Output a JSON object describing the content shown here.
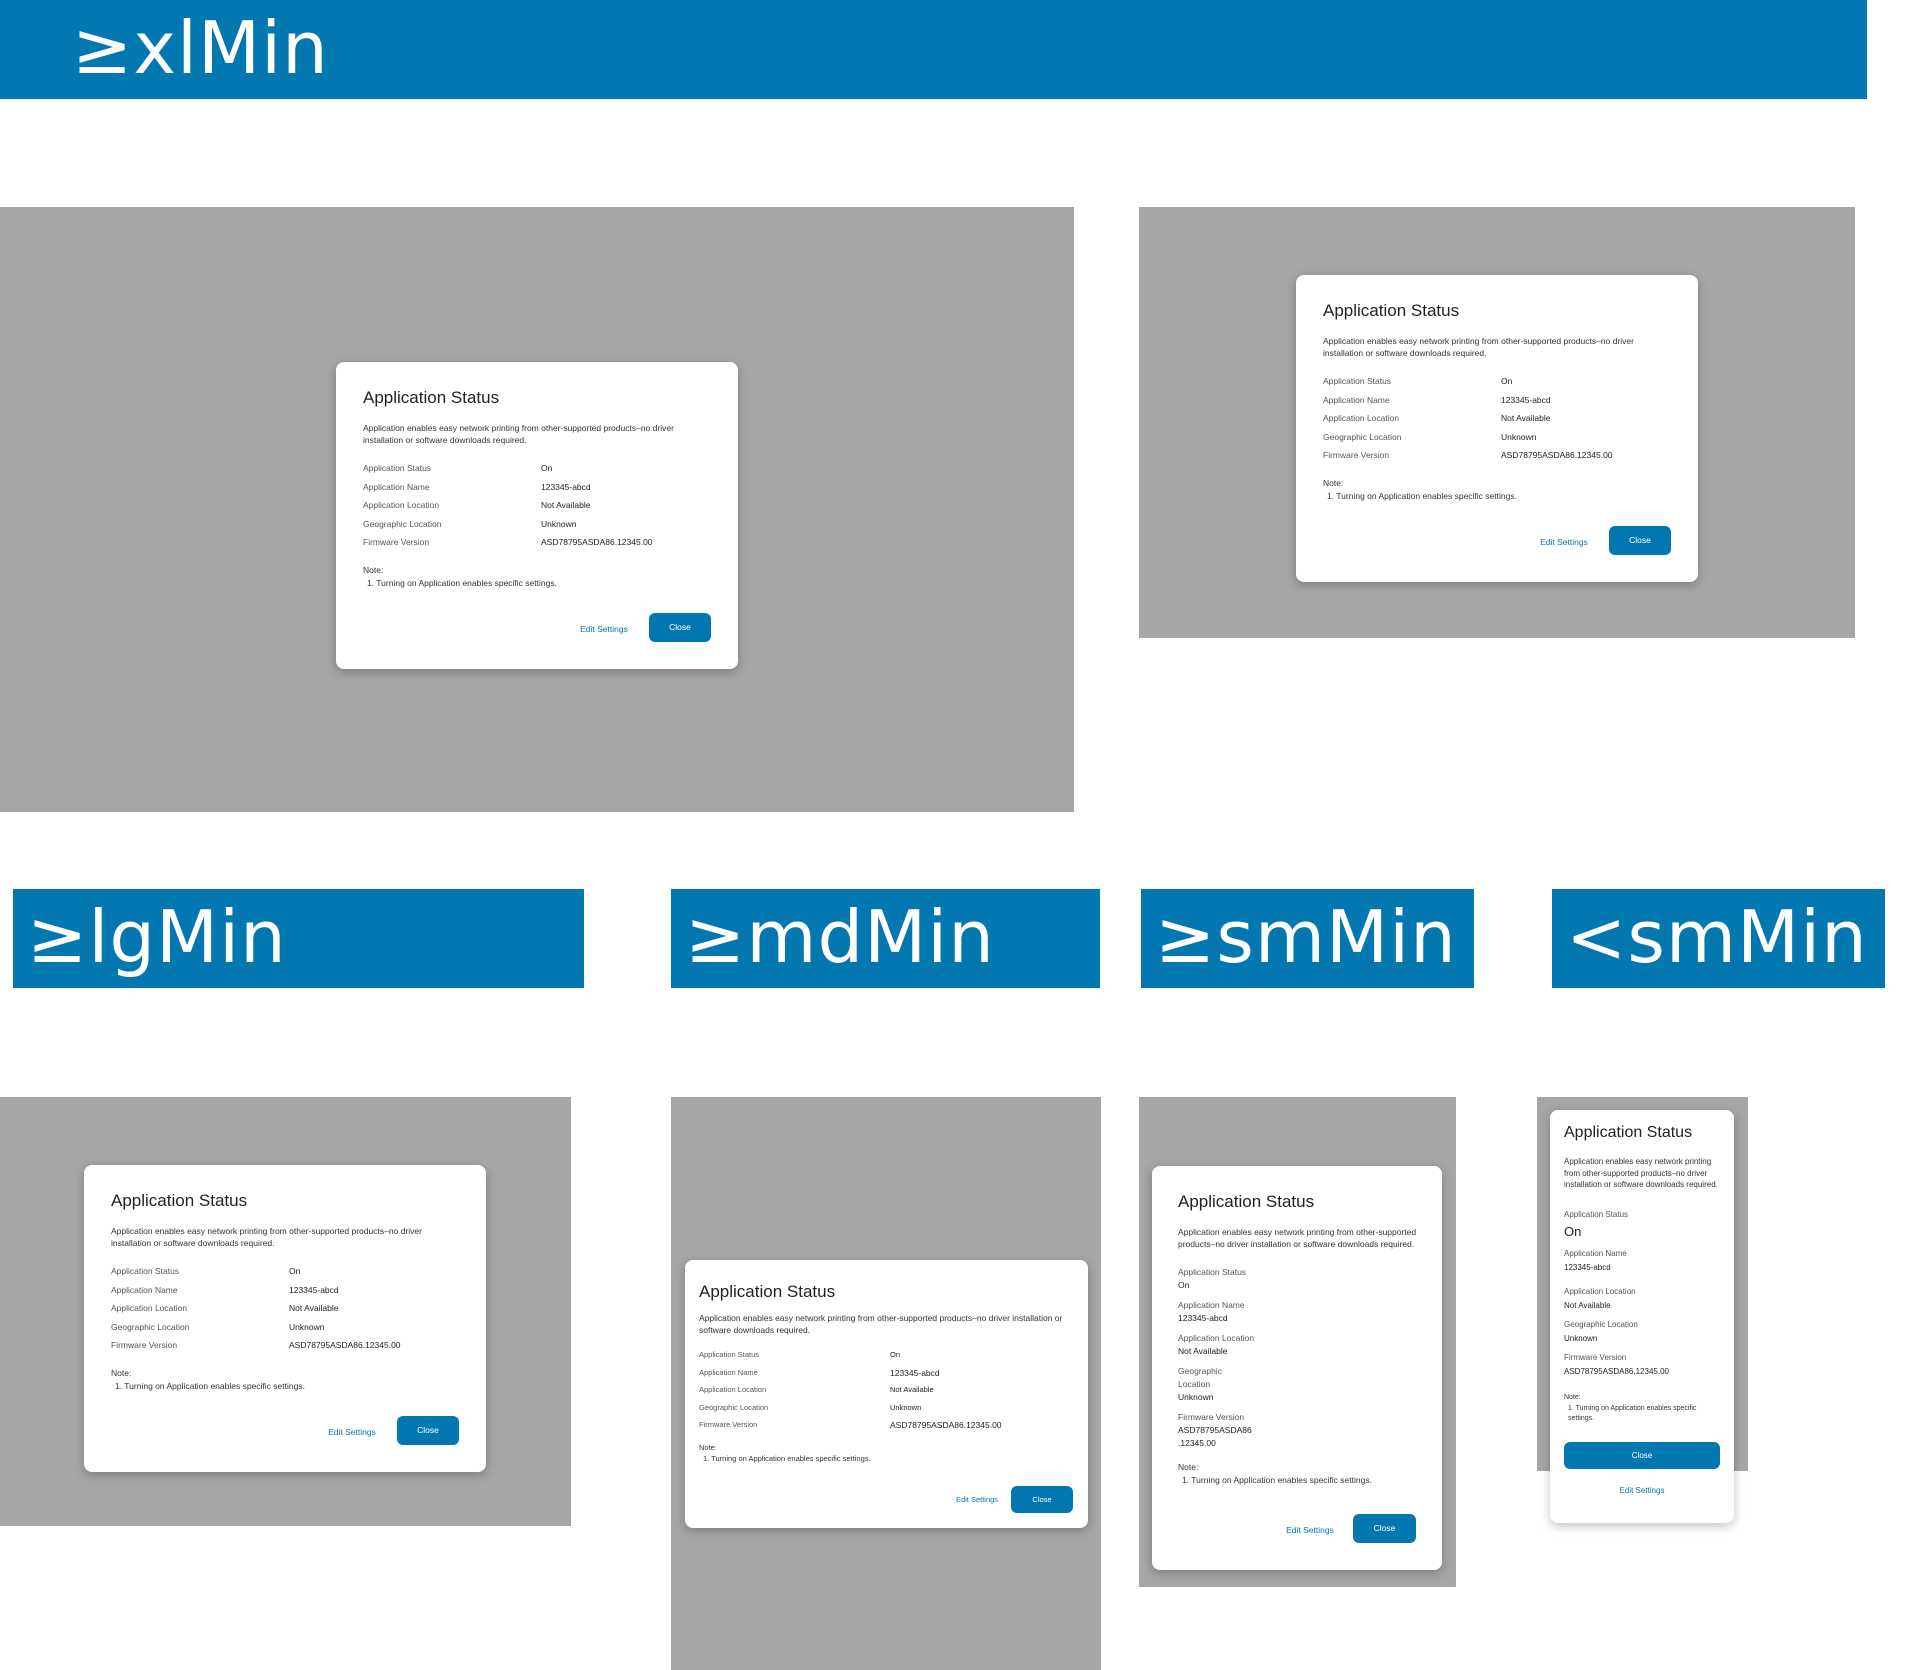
{
  "breakpoints": {
    "xl": "≥xlMin",
    "lg": "≥lgMin",
    "md": "≥mdMin",
    "sm": "≥smMin",
    "xs": "<smMin"
  },
  "dialog": {
    "title": "Application Status",
    "description": "Application enables easy network printing from other-supported products–no driver installation or software downloads required.",
    "fields": [
      {
        "label": "Application Status",
        "value": "On"
      },
      {
        "label": "Application Name",
        "value": "123345-abcd"
      },
      {
        "label": "Application Location",
        "value": "Not Available"
      },
      {
        "label": "Geographic Location",
        "value": "Unknown"
      },
      {
        "label": "Firmware Version",
        "value": "ASD78795ASDA86.12345.00"
      }
    ],
    "note_label": "Note:",
    "note_item": "1.  Turning on Application enables specific settings.",
    "edit_label": "Edit Settings",
    "close_label": "Close",
    "sm_geo_label_line1": "Geographic",
    "sm_geo_label_line2": "Location",
    "sm_fw_value_line1": "ASD78795ASDA86",
    "sm_fw_value_line2": ".12345.00"
  },
  "colors": {
    "banner": "#0378b0",
    "backdrop": "#a6a6a6",
    "primary": "#0378b0"
  }
}
